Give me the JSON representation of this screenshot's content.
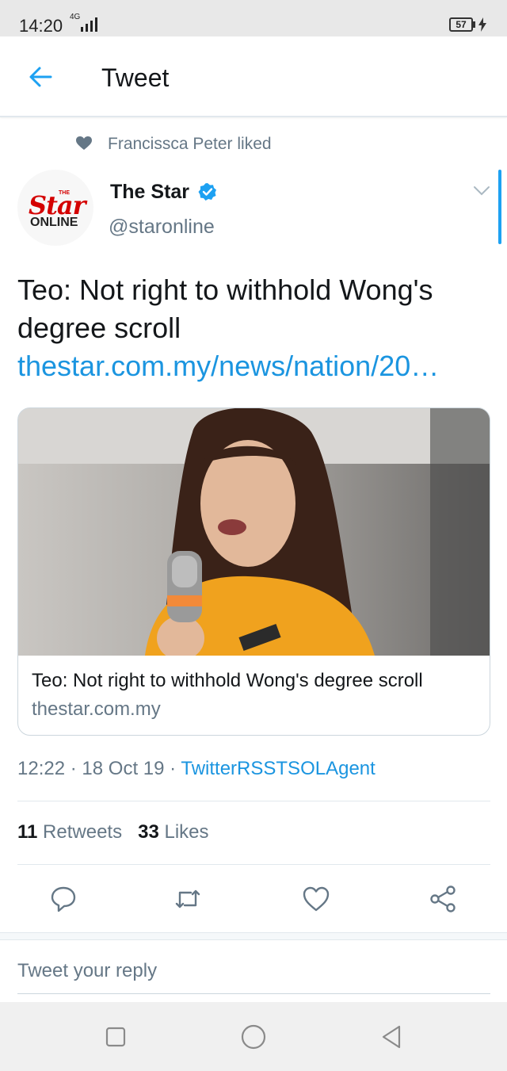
{
  "status_bar": {
    "time": "14:20",
    "network": "4G",
    "battery": "57"
  },
  "header": {
    "title": "Tweet",
    "back_icon": "arrow-left-icon"
  },
  "social_context": {
    "icon": "heart-icon",
    "text": "Francissca Peter liked"
  },
  "tweet": {
    "avatar": {
      "brand_small": "THE",
      "brand_main": "Star",
      "brand_sub": "ONLINE"
    },
    "display_name": "The Star",
    "verified_icon": "verified-badge-icon",
    "handle": "@staronline",
    "text": "Teo: Not right to withhold Wong's degree scroll",
    "link": "thestar.com.my/news/nation/20…",
    "card": {
      "image_alt": "woman speaking into a microphone",
      "title": "Teo: Not right to withhold Wong's degree scroll",
      "domain": "thestar.com.my"
    },
    "time": "12:22",
    "date": "18 Oct 19",
    "source": "TwitterRSSTSOLAgent",
    "retweets_count": "11",
    "retweets_label": "Retweets",
    "likes_count": "33",
    "likes_label": "Likes"
  },
  "actions": [
    "reply-icon",
    "retweet-icon",
    "like-icon",
    "share-icon"
  ],
  "reply": {
    "placeholder": "Tweet your reply"
  },
  "nav": [
    "recent-apps-icon",
    "home-icon",
    "back-icon"
  ],
  "colors": {
    "link_blue": "#1b95e0",
    "accent_blue": "#1da1f2",
    "secondary_text": "#657786",
    "brand_red": "#d40000"
  }
}
